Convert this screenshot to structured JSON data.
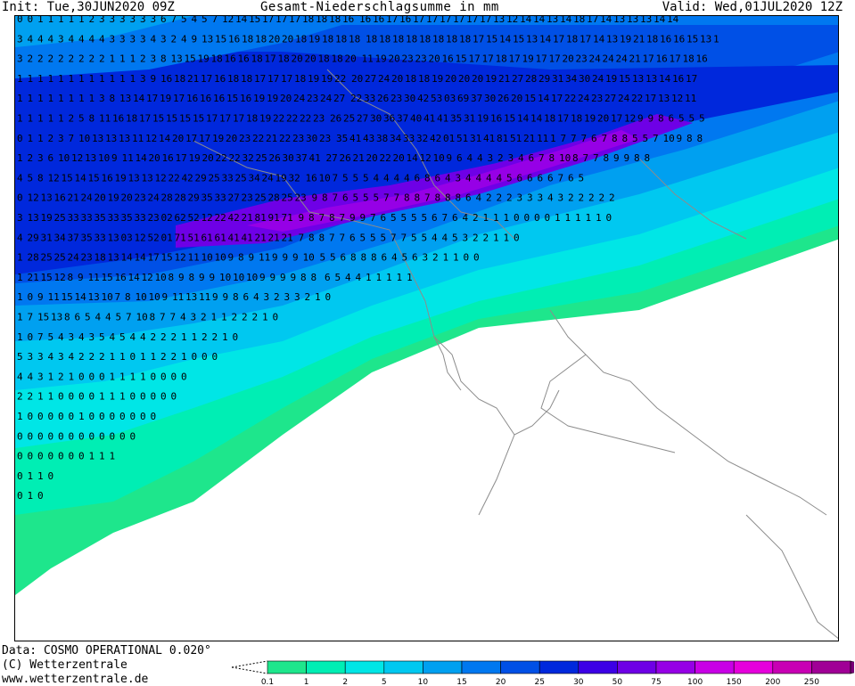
{
  "header": {
    "init": "Init: Tue,30JUN2020 09Z",
    "title": "Gesamt-Niederschlagsumme in mm",
    "valid": "Valid: Wed,01JUL2020 12Z"
  },
  "footer": {
    "data_line": "Data: COSMO OPERATIONAL 0.020°",
    "copyright": "(C) Wetterzentrale",
    "url": "www.wetterzentrale.de"
  },
  "legend": {
    "labels": [
      "0.1",
      "1",
      "2",
      "5",
      "10",
      "15",
      "20",
      "25",
      "30",
      "50",
      "75",
      "100",
      "150",
      "200",
      "250"
    ],
    "colors": [
      "#1ee68c",
      "#00eeb4",
      "#00e6e6",
      "#00c8f0",
      "#00a0f0",
      "#0078f0",
      "#0050e6",
      "#0028dc",
      "#3c00e6",
      "#6e00e6",
      "#9600e6",
      "#c800e6",
      "#e600dc",
      "#c800b4",
      "#a00096",
      "#780078"
    ]
  },
  "map": {
    "rows": [
      "0 0 1 1 1 1 1 2 3 3 3 3 3 3 6 7 5 4 5 7 12 14 15 17 17 17 18 18 18 16",
      "3 4 4 4 3 4 4 4 4 3 3 3 3 4 3 2 4 9 13 15 16 18 18 20 20 18 19 18 18 18",
      "3 2 2 2 2 2 2 2 2 1 1 1 2 3 8 13 15 19 18 16 16 18 17 18 20 20 18 18 20",
      "1 1 1 1 1 1 1 1 1 1 1 1 3 9 16 18 21 17 16 18 18 17 17 17 18 19 19 22",
      "1 1 1 1 1 1 1 1 3 8 13 14 17 19 17 16 16 16 15 16 19 19 20 24 23 24 27",
      "1 1 1 1 1 2 5 8 11 16 18 17 15 15 15 15 17 17 17 18 19 22 22 22 23",
      "0 1 1 2 3 7 10 13 13 13 11 12 14 20 17 17 19 20 23 22 21 22 23 30 23",
      "1 2 3 6 10 12 13 10 9 11 14 20 16 17 19 20 22 22 32 25 26 30 37 41",
      "4 5 8 12 15 14 15 16 19 13 13 12 22 42 29 25 33 25 34 24 19 32",
      "0 12 13 16 21 24 20 19 20 23 24 28 28 29 35 33 27 23 25 28 25 23",
      "3 13 19 25 33 33 35 33 35 33 23 02 62 52 12 22 42 21 81 91 71",
      "4 29 31 34 37 35 33 13 03 12 52 01 71 51 61 61 41 41 21 21 21",
      "1 28 25 25 24 23 18 13 14 14 17 15 12 11 10 10 9 8 9 11 9 9 9 10",
      "1 21 15 12 8 9 11 15 16 14 12 10 8 9 8 9 9 10 10 10 9 9 9 9 8 8",
      "1 0 9 11 15 14 13 10 7 8 10 10 9 11 13 11 9 9 8 6 4 3 2 3 3 2 1 0",
      "1 7 15 13 8 6 5 4 4 5 7 10 8 7 7 4 3 2 1 1 2 2 2 1 0",
      "1 0 7 5 4 3 4 3 5 4 5 4 4 2 2 2 1 1 2 2 1 0",
      "5 3 3 4 3 4 2 2 2 1 1 0 1 1 2 2 1 0 0 0",
      "4 4 3 1 2 1 0 0 0 1 1 1 1 0 0 0 0",
      "2 2 1 1 0 0 0 0 1 1 1 0 0 0 0 0",
      "1 0 0 0 0 0 1 0 0 0 0 0 0 0",
      "0 0 0 0 0 0 0 0 0 0 0 0",
      "0 0 0 0 0 0 0 1 1 1",
      "0 1 1 0",
      "0 1 0"
    ],
    "rows_east": [
      "16 16 17 16 17 17 17 17 17 17 13 12 14 14 13 14 18 17 14 13 13 13 14 14",
      "18 18 18 18 18 18 18 18 17 15 14 15 13 14 17 18 17 14 13 19 21 18 16 16 15 13 1",
      "11 19 20 23 23 20 16 15 17 17 18 17 19 17 17 20 23 24 24 24 21 17 16 17 18 16",
      "20 27 24 20 18 18 19 20 20 20 19 21 27 28 29 31 34 30 24 19 15 13 13 14 16 17",
      "22 33 26 23 30 42 53 03 69 37 30 26 20 15 14 17 22 24 23 27 24 22 17 13 12 11",
      "26 25 27 30 36 37 40 41 41 35 31 19 16 15 14 14 18 17 18 19 20 17 12 9 9 8 6 5 5 5",
      "35 41 43 38 34 33 32 42 01 51 31 41 81 51 21 11 1 7 7 7 6 7 8 8 5 5 7 10 9 8 8",
      "27 26 21 20 22 20 14 12 10 9 6 4 4 3 2 3 4 6 7 8 10 8 7 7 8 9 9 8 8",
      "16 10 7 5 5 5 4 4 4 4 6 8 6 4 3 4 4 4 4 5 6 6 6 6 7 6 5",
      "9 8 7 6 5 5 5 7 7 8 8 7 8 8 8 6 4 2 2 2 3 3 3 4 3 2 2 2 2 2",
      "9 8 7 8 7 9 9 7 6 5 5 5 5 6 7 6 4 2 1 1 1 0 0 0 0 1 1 1 1 1 0",
      "7 8 8 7 7 6 5 5 5 7 7 5 5 4 4 5 3 2 2 1 1 0",
      "5 5 6 8 8 8 6 4 5 6 3 2 1 1 0 0",
      "6 5 4 4 1 1 1 1 1"
    ]
  }
}
